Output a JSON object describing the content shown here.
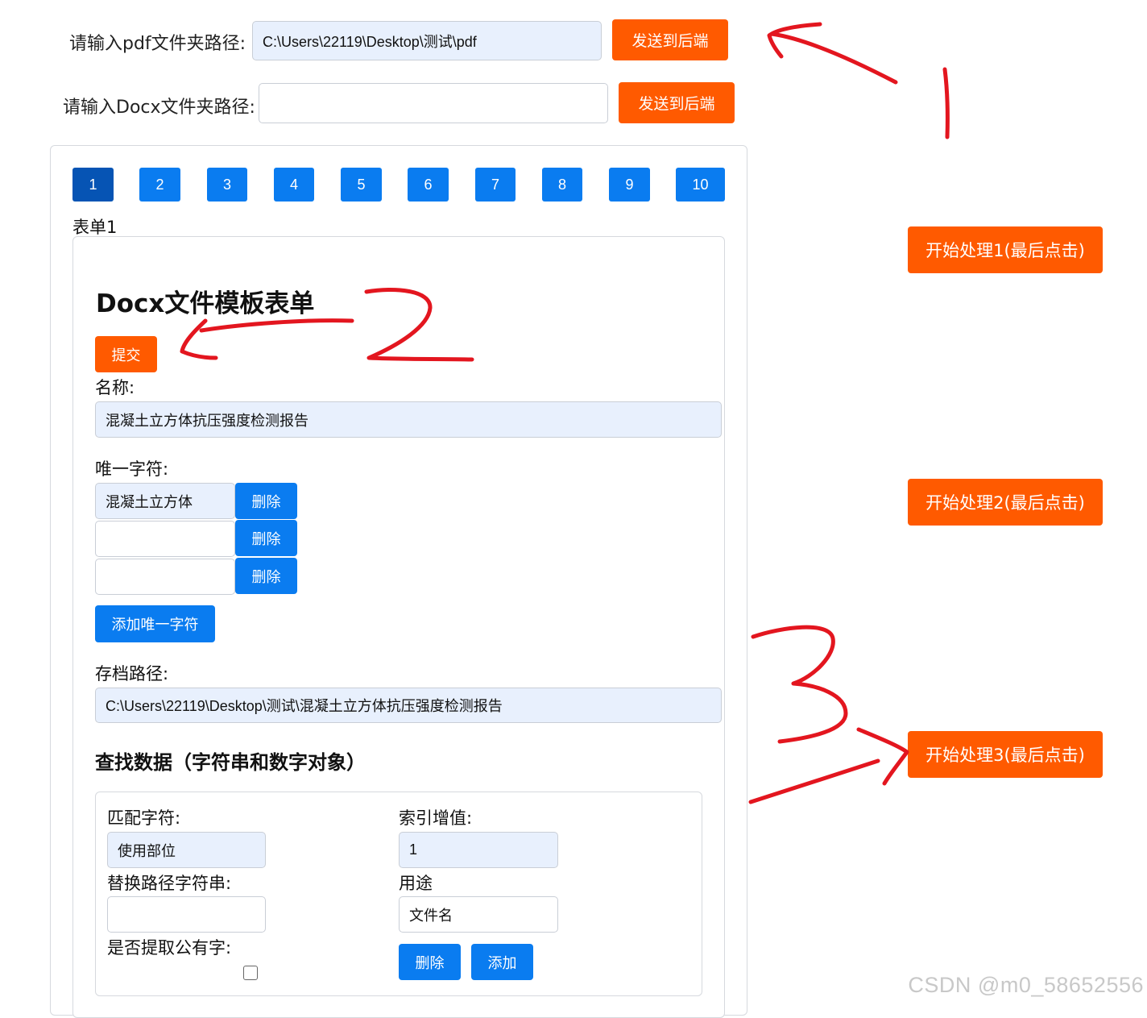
{
  "top": {
    "pdf_label": "请输入pdf文件夹路径:",
    "pdf_value": "C:\\Users\\22119\\Desktop\\测试\\pdf",
    "docx_label": "请输入Docx文件夹路径:",
    "docx_value": "",
    "send_label": "发送到后端"
  },
  "pagination": [
    "1",
    "2",
    "3",
    "4",
    "5",
    "6",
    "7",
    "8",
    "9",
    "10"
  ],
  "form_tab_label": "表单1",
  "form": {
    "title": "Docx文件模板表单",
    "submit_label": "提交",
    "name_label": "名称:",
    "name_value": "混凝土立方体抗压强度检测报告",
    "unique_label": "唯一字符:",
    "unique_values": [
      "混凝土立方体",
      "",
      ""
    ],
    "delete_label": "删除",
    "add_unique_label": "添加唯一字符",
    "archive_label": "存档路径:",
    "archive_value": "C:\\Users\\22119\\Desktop\\测试\\混凝土立方体抗压强度检测报告",
    "search_title": "查找数据（字符串和数字对象）",
    "match_label": "匹配字符:",
    "match_value": "使用部位",
    "index_label": "索引增值:",
    "index_value": "1",
    "replace_label": "替换路径字符串:",
    "replace_value": "",
    "usage_label": "用途",
    "usage_value": "文件名",
    "extract_label": "是否提取公有字:",
    "extract_checked": false,
    "row_delete_label": "删除",
    "row_add_label": "添加"
  },
  "side_buttons": [
    "开始处理1(最后点击)",
    "开始处理2(最后点击)",
    "开始处理3(最后点击)"
  ],
  "watermark": "CSDN @m0_58652556",
  "colors": {
    "accent_orange": "#ff5a00",
    "accent_blue": "#0a7cf0",
    "active_page": "#0654b4",
    "filled_input": "#e8f0fd",
    "annotation_red": "#e3161f"
  }
}
